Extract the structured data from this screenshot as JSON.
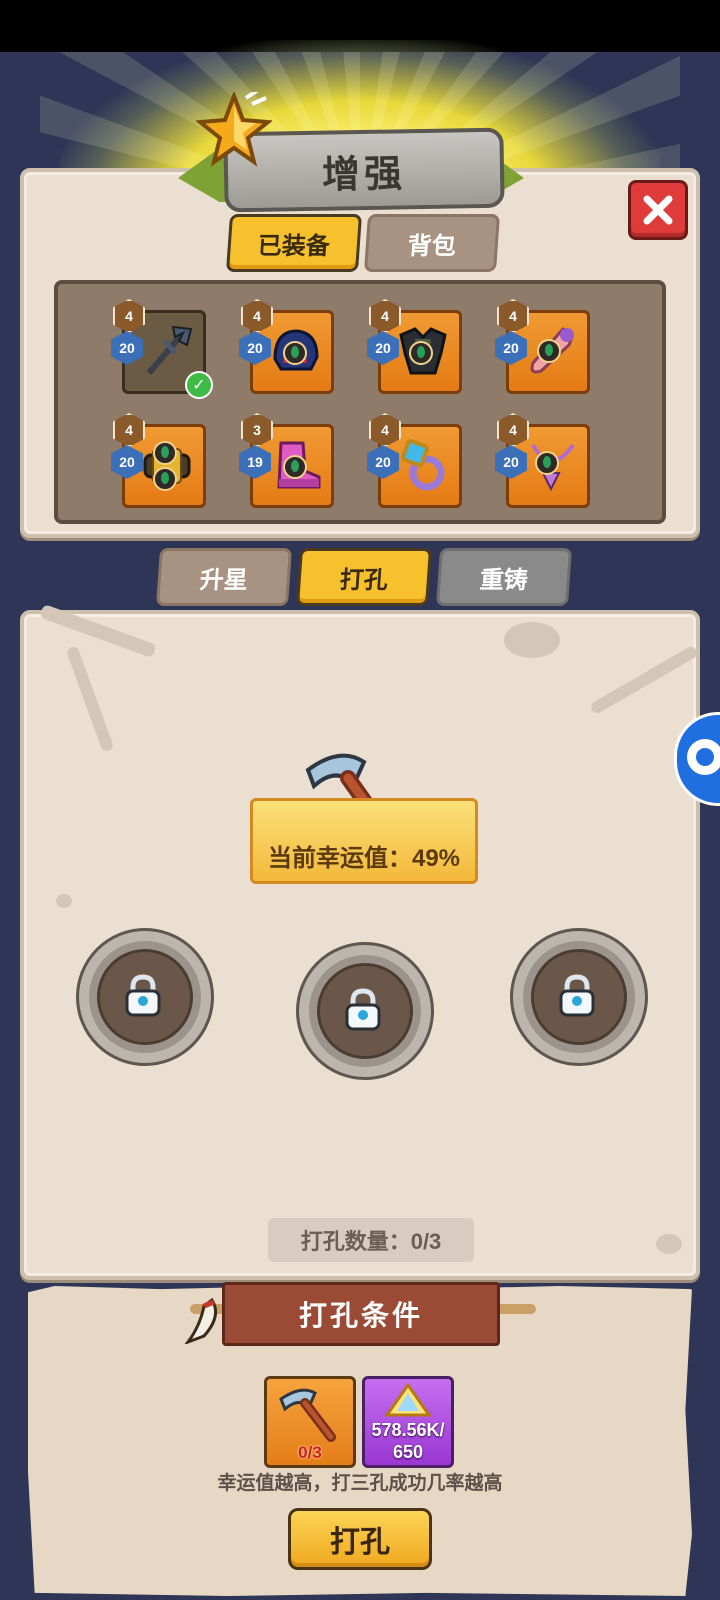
{
  "title": "增强",
  "tabs_top": [
    {
      "label": "已装备",
      "active": true
    },
    {
      "label": "背包",
      "active": false
    }
  ],
  "equipment": [
    {
      "icon": "trident-weapon-icon",
      "level": "4",
      "stars": "20",
      "equipped": true
    },
    {
      "icon": "helmet-icon",
      "level": "4",
      "stars": "20"
    },
    {
      "icon": "armor-icon",
      "level": "4",
      "stars": "20"
    },
    {
      "icon": "scroll-icon",
      "level": "4",
      "stars": "20"
    },
    {
      "icon": "belt-icon",
      "level": "4",
      "stars": "20"
    },
    {
      "icon": "boots-icon",
      "level": "3",
      "stars": "19"
    },
    {
      "icon": "ring-icon",
      "level": "4",
      "stars": "20"
    },
    {
      "icon": "necklace-icon",
      "level": "4",
      "stars": "20"
    }
  ],
  "tabs_mid": [
    {
      "label": "升星",
      "active": false
    },
    {
      "label": "打孔",
      "active": true
    },
    {
      "label": "重铸",
      "active": false
    }
  ],
  "luck_text": "当前幸运值：49%",
  "socket_count_text": "打孔数量：0/3",
  "conditions_title": "打孔条件",
  "costs": [
    {
      "icon": "pickaxe-icon",
      "qty": "0/3"
    },
    {
      "icon": "crystal-icon",
      "qty_line1": "578.56K/",
      "qty_line2": "650"
    }
  ],
  "hint": "幸运值越高，打三孔成功几率越高",
  "action_label": "打孔",
  "colors": {
    "accent": "#f6c12d",
    "background": "#2e3556",
    "close": "#e03b3b"
  }
}
